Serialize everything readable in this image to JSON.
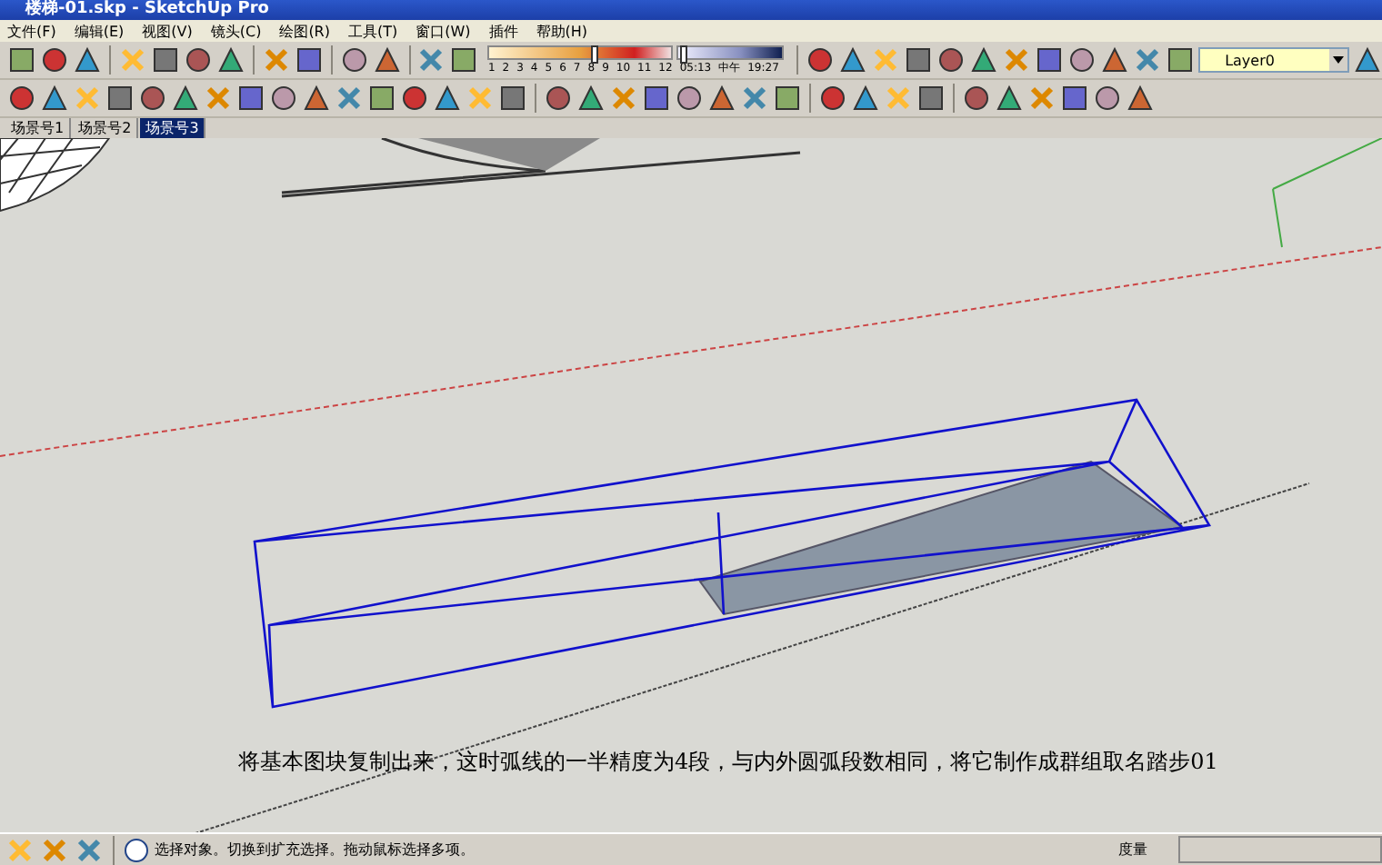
{
  "window": {
    "title": "楼梯-01.skp - SketchUp Pro"
  },
  "menu": [
    "文件(F)",
    "编辑(E)",
    "视图(V)",
    "镜头(C)",
    "绘图(R)",
    "工具(T)",
    "窗口(W)",
    "插件",
    "帮助(H)"
  ],
  "shadow_bar": {
    "month_slider": {
      "level": 0.58
    },
    "time_slider": {
      "level": 0.05
    },
    "month_ticks": [
      "1",
      "2",
      "3",
      "4",
      "5",
      "6",
      "7",
      "8",
      "9",
      "10",
      "11",
      "12"
    ],
    "time_start": "05:13",
    "time_mid": "中午",
    "time_end": "19:27"
  },
  "layer_select": {
    "value": "Layer0"
  },
  "scene_tabs": [
    {
      "label": "场景号1",
      "selected": false
    },
    {
      "label": "场景号2",
      "selected": false
    },
    {
      "label": "场景号3",
      "selected": true
    }
  ],
  "caption": "将基本图块复制出来，这时弧线的一半精度为4段，与内外圆弧段数相同，将它制作成群组取名踏步01",
  "status_bar": {
    "message": "选择对象。切换到扩充选择。拖动鼠标选择多项。",
    "measure_label": "度量"
  }
}
